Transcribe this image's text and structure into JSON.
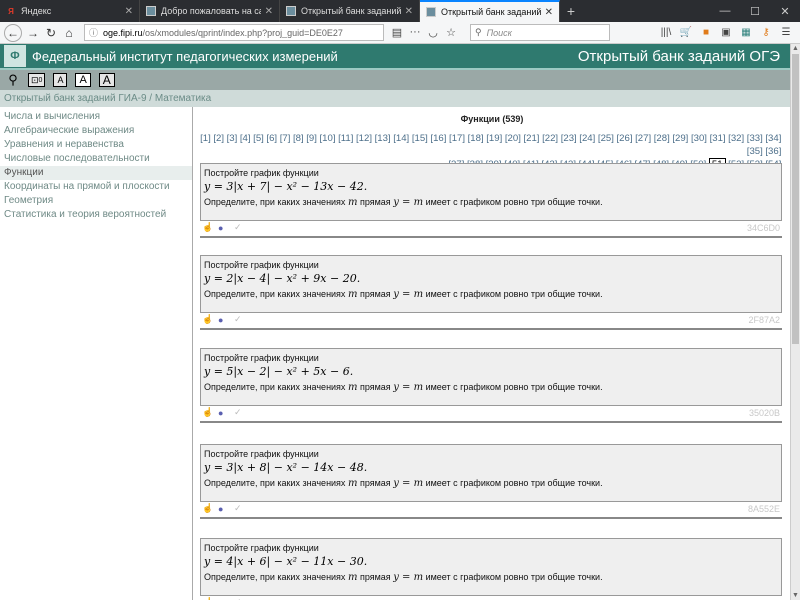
{
  "browser": {
    "tabs": [
      {
        "title": "Яндекс",
        "icon": "yandex-icon",
        "active": false
      },
      {
        "title": "Добро пожаловать на сайт Ф",
        "icon": "fipi-icon",
        "active": false
      },
      {
        "title": "Открытый банк заданий ОГЭ",
        "icon": "fipi-icon",
        "active": false
      },
      {
        "title": "Открытый банк заданий ОГЭ",
        "icon": "fipi-icon",
        "active": true
      }
    ],
    "url_domain": "oge.fipi.ru",
    "url_path": "/os/xmodules/qprint/index.php?proj_guid=DE0E27",
    "search_placeholder": "Поиск"
  },
  "site": {
    "name": "Федеральный институт педагогических измерений",
    "bank_title": "Открытый банк заданий ОГЭ",
    "breadcrumb": "Открытый банк заданий ГИА-9 / Математика",
    "toolbar": {
      "counter": "0",
      "font_small": "A",
      "font_medium": "A",
      "font_large": "A"
    }
  },
  "sidebar": {
    "items": [
      "Числа и вычисления",
      "Алгебраические выражения",
      "Уравнения и неравенства",
      "Числовые последовательности",
      "Функции",
      "Координаты на прямой и плоскости",
      "Геометрия",
      "Статистика и теория вероятностей"
    ],
    "active_index": 4
  },
  "main": {
    "section_title": "Функции (539)",
    "pages_row1": [
      "[1]",
      "[2]",
      "[3]",
      "[4]",
      "[5]",
      "[6]",
      "[7]",
      "[8]",
      "[9]",
      "[10]",
      "[11]",
      "[12]",
      "[13]",
      "[14]",
      "[15]",
      "[16]",
      "[17]",
      "[18]",
      "[19]",
      "[20]",
      "[21]",
      "[22]",
      "[23]",
      "[24]",
      "[25]",
      "[26]",
      "[27]",
      "[28]",
      "[29]",
      "[30]",
      "[31]",
      "[32]",
      "[33]",
      "[34]",
      "[35]",
      "[36]"
    ],
    "pages_row2": [
      "[37]",
      "[38]",
      "[39]",
      "[40]",
      "[41]",
      "[42]",
      "[43]",
      "[44]",
      "[45]",
      "[46]",
      "[47]",
      "[48]",
      "[49]",
      "[50]",
      "51",
      "[52]",
      "[53]",
      "[54]"
    ],
    "current_page": "51",
    "tasks": [
      {
        "intro": "Постройте график функции",
        "formula": "y = 3|x + 7| − x² − 13x − 42.",
        "q_prefix": "Определите, при каких значениях",
        "q_var1": "m",
        "q_mid": "прямая",
        "q_var2": "y = m",
        "q_suffix": "имеет с графиком ровно три общие точки.",
        "code": "34C6D0"
      },
      {
        "intro": "Постройте график функции",
        "formula": "y = 2|x − 4| − x² + 9x − 20.",
        "q_prefix": "Определите, при каких значениях",
        "q_var1": "m",
        "q_mid": "прямая",
        "q_var2": "y = m",
        "q_suffix": "имеет с графиком ровно три общие точки.",
        "code": "2F87A2"
      },
      {
        "intro": "Постройте график функции",
        "formula": "y = 5|x − 2| − x² + 5x − 6.",
        "q_prefix": "Определите, при каких значениях",
        "q_var1": "m",
        "q_mid": "прямая",
        "q_var2": "y = m",
        "q_suffix": "имеет с графиком ровно три общие точки.",
        "code": "35020B"
      },
      {
        "intro": "Постройте график функции",
        "formula": "y = 3|x + 8| − x² − 14x − 48.",
        "q_prefix": "Определите, при каких значениях",
        "q_var1": "m",
        "q_mid": "прямая",
        "q_var2": "y = m",
        "q_suffix": "имеет с графиком ровно три общие точки.",
        "code": "8A552E"
      },
      {
        "intro": "Постройте график функции",
        "formula": "y = 4|x + 6| − x² − 11x − 30.",
        "q_prefix": "Определите, при каких значениях",
        "q_var1": "m",
        "q_mid": "прямая",
        "q_var2": "y = m",
        "q_suffix": "имеет с графиком ровно три общие точки.",
        "code": ""
      }
    ]
  }
}
